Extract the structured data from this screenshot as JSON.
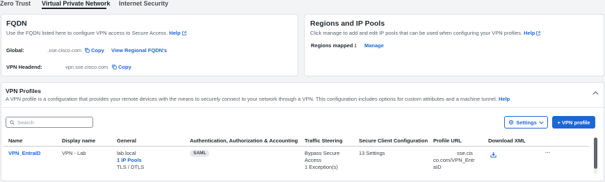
{
  "tabs": [
    {
      "label": "Zero Trust"
    },
    {
      "label": "Virtual Private Network"
    },
    {
      "label": "Internet Security"
    }
  ],
  "fqdn": {
    "title": "FQDN",
    "description": "Use the FQDN listed here to configure VPN access to Secure Access.",
    "help_label": "Help",
    "global_label": "Global:",
    "global_value": ".sse.cisco.com",
    "copy_label": "Copy",
    "regional_link": "View Regional FQDN's",
    "headend_label": "VPN Headend:",
    "headend_value": "vpn.sse.cisco.com",
    "copy_label_2": "Copy"
  },
  "regions": {
    "title": "Regions and IP Pools",
    "description": "Click manage to add and edit IP pools that can be used when configuring your VPN profiles.",
    "help_label": "Help",
    "mapped_label": "Regions mapped",
    "mapped_count": "1",
    "manage_label": "Manage"
  },
  "profiles": {
    "title": "VPN Profiles",
    "description": "A VPN profile is a configuration that provides your remote devices with the means to securely connect to your network through a VPN. This configuration includes options for custom attributes and a machine tunnel.",
    "help_label": "Help",
    "search_placeholder": "Search",
    "settings_label": "Settings",
    "add_label": "+ VPN profile",
    "columns": [
      "Name",
      "Display name",
      "General",
      "Authentication, Authorization & Accounting",
      "Traffic Steering",
      "Secure Client Configuration",
      "Profile URL",
      "Download XML"
    ],
    "row": {
      "name": "VPN_EntraID",
      "display_name": "VPN - Lab",
      "general_1": "lab.local",
      "general_2": "1 IP Pools",
      "general_3": "TLS / DTLS",
      "aaa": "SAML",
      "traffic_1": "Bypass Secure",
      "traffic_2": "Access",
      "traffic_3": "1 Exception(s)",
      "client_config": "13 Settings",
      "url_1": "sse.cis",
      "url_2": "co.com/VPN_Entr",
      "url_3": "aID",
      "more": "···"
    }
  },
  "colors": {
    "accent": "#1e66d6",
    "text": "#23282e",
    "background": "#f3f4f6"
  }
}
